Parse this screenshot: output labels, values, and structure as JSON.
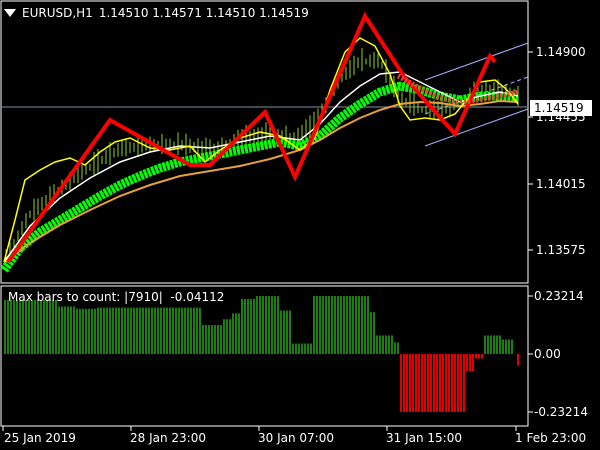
{
  "header": {
    "symbol": "EURUSD,H1",
    "ohlc": "1.14510 1.14571 1.14510 1.14519",
    "menu_icon": "triangle-down-icon"
  },
  "price_axis": {
    "ticks": [
      "1.14900",
      "1.14455",
      "1.14015",
      "1.13575"
    ],
    "current_price": "1.14519"
  },
  "indicator": {
    "label": "Max bars to count: |7910|  -0.04112",
    "ticks": [
      "0.23214",
      "0.00",
      "-0.23214"
    ]
  },
  "time_axis": {
    "labels": [
      "25 Jan 2019",
      "28 Jan 23:00",
      "30 Jan 07:00",
      "31 Jan 15:00",
      "1 Feb 23:00"
    ]
  },
  "colors": {
    "background": "#000000",
    "frame": "#ffffff",
    "zigzag": "#ff0000",
    "fast_ma": "#ffff00",
    "slow_ma": "#ffffff",
    "baseline_ma": "#e6a13c",
    "band": "#00ff00",
    "hist_positive": "#1e7e14",
    "hist_negative": "#e00000",
    "candles": "#8fd12a"
  },
  "chart_data": {
    "type": "line",
    "x": [
      "25 Jan 2019",
      "28 Jan 23:00",
      "30 Jan 07:00",
      "31 Jan 15:00",
      "1 Feb 23:00"
    ],
    "series": [],
    "ylim": [
      1.1335,
      1.1512
    ],
    "hist_ylim": [
      -0.26,
      0.26
    ],
    "current": 1.14519,
    "hist_last": -0.04112
  }
}
